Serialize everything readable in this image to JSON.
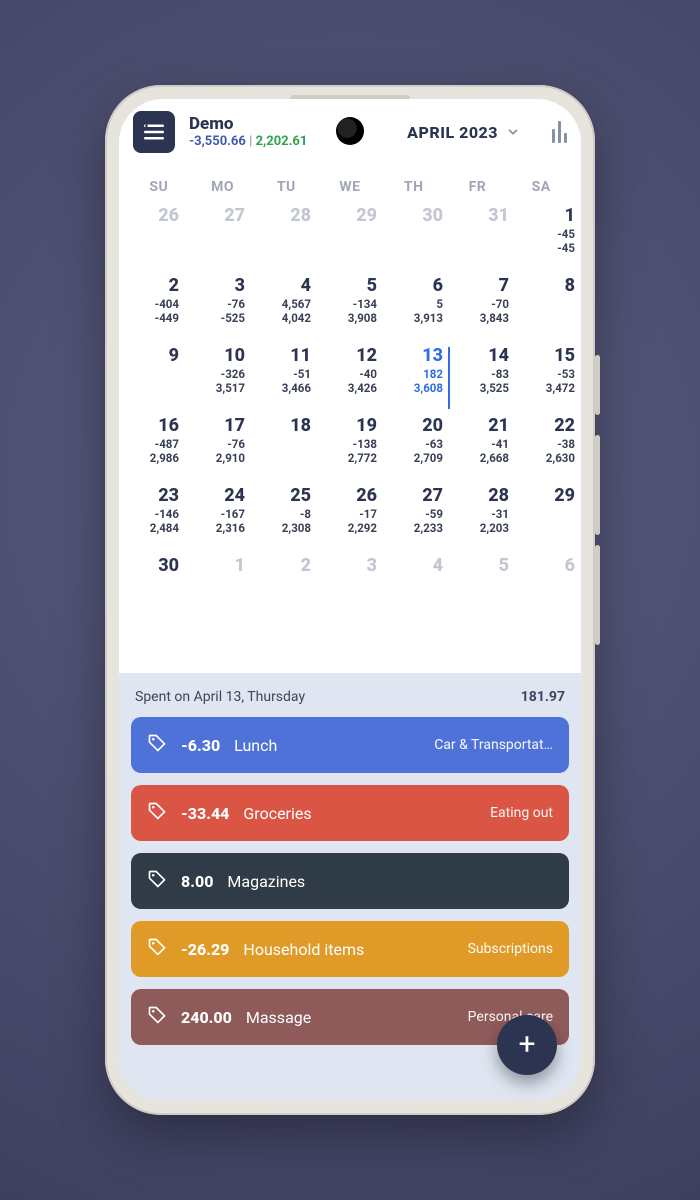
{
  "header": {
    "account_name": "Demo",
    "balance_negative": "-3,550.66",
    "balance_separator": " | ",
    "balance_positive": "2,202.61",
    "month_label": "APRIL 2023"
  },
  "calendar": {
    "dow": [
      "SU",
      "MO",
      "TU",
      "WE",
      "TH",
      "FR",
      "SA"
    ],
    "cells": [
      {
        "n": "26",
        "muted": true
      },
      {
        "n": "27",
        "muted": true
      },
      {
        "n": "28",
        "muted": true
      },
      {
        "n": "29",
        "muted": true
      },
      {
        "n": "30",
        "muted": true
      },
      {
        "n": "31",
        "muted": true
      },
      {
        "n": "1",
        "v1": "-45",
        "v2": "-45"
      },
      {
        "n": "2",
        "v1": "-404",
        "v2": "-449"
      },
      {
        "n": "3",
        "v1": "-76",
        "v2": "-525"
      },
      {
        "n": "4",
        "v1": "4,567",
        "v2": "4,042"
      },
      {
        "n": "5",
        "v1": "-134",
        "v2": "3,908"
      },
      {
        "n": "6",
        "v1": "5",
        "v2": "3,913"
      },
      {
        "n": "7",
        "v1": "-70",
        "v2": "3,843"
      },
      {
        "n": "8"
      },
      {
        "n": "9"
      },
      {
        "n": "10",
        "v1": "-326",
        "v2": "3,517"
      },
      {
        "n": "11",
        "v1": "-51",
        "v2": "3,466"
      },
      {
        "n": "12",
        "v1": "-40",
        "v2": "3,426"
      },
      {
        "n": "13",
        "v1": "182",
        "v2": "3,608",
        "today": true
      },
      {
        "n": "14",
        "v1": "-83",
        "v2": "3,525"
      },
      {
        "n": "15",
        "v1": "-53",
        "v2": "3,472"
      },
      {
        "n": "16",
        "v1": "-487",
        "v2": "2,986"
      },
      {
        "n": "17",
        "v1": "-76",
        "v2": "2,910"
      },
      {
        "n": "18"
      },
      {
        "n": "19",
        "v1": "-138",
        "v2": "2,772"
      },
      {
        "n": "20",
        "v1": "-63",
        "v2": "2,709"
      },
      {
        "n": "21",
        "v1": "-41",
        "v2": "2,668"
      },
      {
        "n": "22",
        "v1": "-38",
        "v2": "2,630"
      },
      {
        "n": "23",
        "v1": "-146",
        "v2": "2,484"
      },
      {
        "n": "24",
        "v1": "-167",
        "v2": "2,316"
      },
      {
        "n": "25",
        "v1": "-8",
        "v2": "2,308"
      },
      {
        "n": "26",
        "v1": "-17",
        "v2": "2,292"
      },
      {
        "n": "27",
        "v1": "-59",
        "v2": "2,233"
      },
      {
        "n": "28",
        "v1": "-31",
        "v2": "2,203"
      },
      {
        "n": "29"
      },
      {
        "n": "30"
      },
      {
        "n": "1",
        "muted": true
      },
      {
        "n": "2",
        "muted": true
      },
      {
        "n": "3",
        "muted": true
      },
      {
        "n": "4",
        "muted": true
      },
      {
        "n": "5",
        "muted": true
      },
      {
        "n": "6",
        "muted": true
      }
    ]
  },
  "transactions": {
    "heading": "Spent on April 13, Thursday",
    "heading_amount": "181.97",
    "items": [
      {
        "amount": "-6.30",
        "name": "Lunch",
        "right": "Car & Transportat…",
        "color": "c-blue"
      },
      {
        "amount": "-33.44",
        "name": "Groceries",
        "right": "Eating out",
        "color": "c-red"
      },
      {
        "amount": "8.00",
        "name": "Magazines",
        "right": "",
        "color": "c-dark"
      },
      {
        "amount": "-26.29",
        "name": "Household items",
        "right": "Subscriptions",
        "color": "c-amber"
      },
      {
        "amount": "240.00",
        "name": "Massage",
        "right": "Personal care",
        "color": "c-mauve"
      }
    ]
  },
  "fab": {
    "label": "+"
  }
}
